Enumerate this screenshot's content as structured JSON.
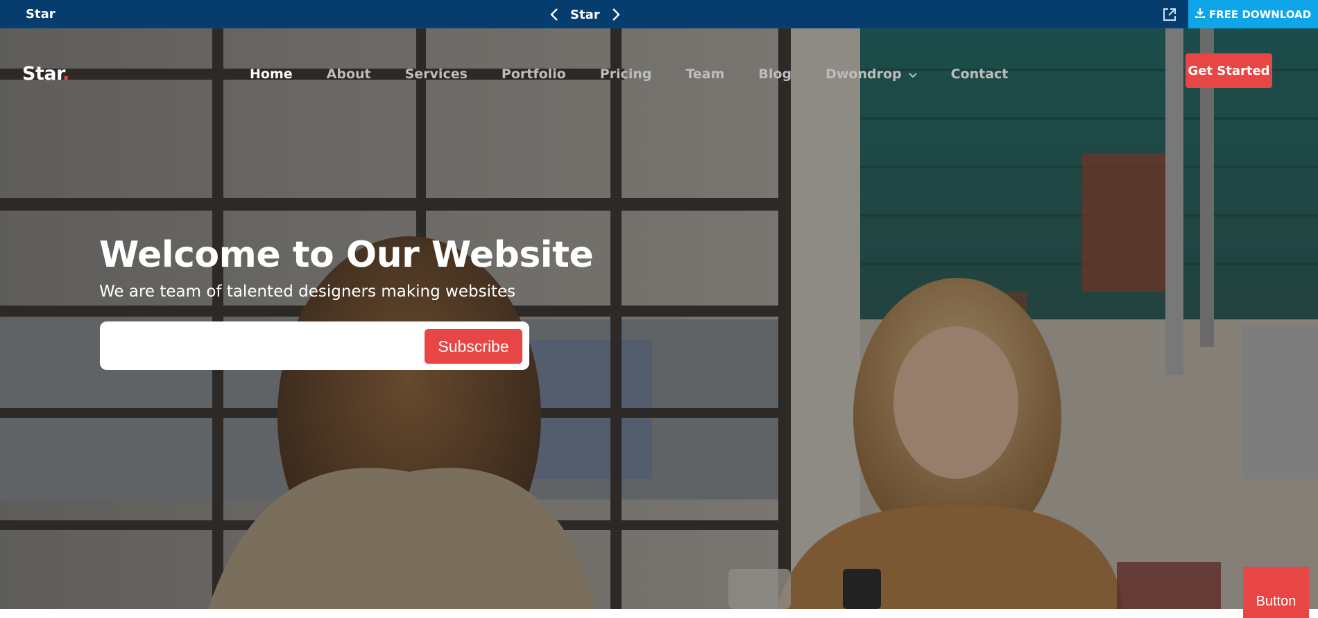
{
  "topbar": {
    "brand": "Star",
    "center_title": "Star",
    "prev_icon": "chevron-left-icon",
    "next_icon": "chevron-right-icon",
    "external_icon": "external-link-icon",
    "download_icon": "download-icon",
    "download_label": "FREE DOWNLOAD",
    "color_bg": "#063d6e",
    "color_download": "#0ea5e9"
  },
  "nav": {
    "logo_text": "Star",
    "logo_dot": ".",
    "items": [
      {
        "label": "Home",
        "active": true
      },
      {
        "label": "About"
      },
      {
        "label": "Services"
      },
      {
        "label": "Portfolio"
      },
      {
        "label": "Pricing"
      },
      {
        "label": "Team"
      },
      {
        "label": "Blog"
      },
      {
        "label": "Dwondrop",
        "icon": "chevron-down-icon"
      },
      {
        "label": "Contact"
      }
    ],
    "cta_label": "Get Started"
  },
  "hero": {
    "title": "Welcome to Our Website",
    "subtitle": "We are team of talented designers making websites",
    "subscribe_placeholder": "",
    "subscribe_label": "Subscribe",
    "accent_color": "#e84545"
  },
  "corner_button_label": "Button"
}
